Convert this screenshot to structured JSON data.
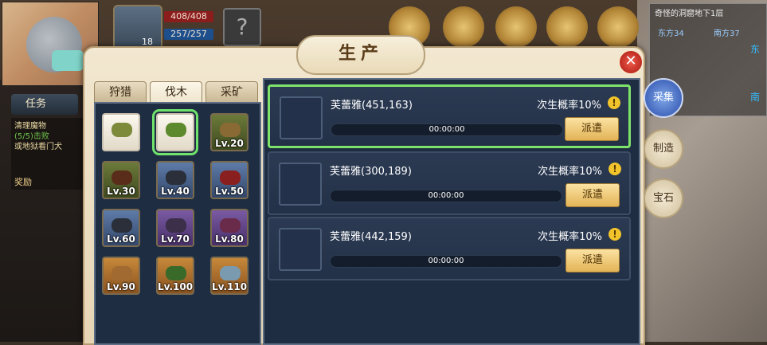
{
  "hud": {
    "hp": "408/408",
    "mp": "257/257",
    "level": "18"
  },
  "minimap": {
    "title": "奇怪的洞窟地下1层",
    "coord_a": "东方34",
    "coord_b": "南方37",
    "east": "东",
    "south": "南"
  },
  "task": {
    "tab_label": "任务",
    "line1": "清理魔物",
    "line2": "(5/5)击败",
    "line3": "或地狱看门犬",
    "reward": "奖励"
  },
  "dialog": {
    "title": "生产",
    "close": "✕",
    "tabs": [
      "狩猎",
      "伐木",
      "采矿"
    ],
    "active_tab": "伐木",
    "slots": [
      {
        "lv": "",
        "color": "white"
      },
      {
        "lv": "",
        "color": "white",
        "selected": true
      },
      {
        "lv": "Lv.20",
        "color": "green"
      },
      {
        "lv": "Lv.30",
        "color": "green"
      },
      {
        "lv": "Lv.40",
        "color": "blue"
      },
      {
        "lv": "Lv.50",
        "color": "blue"
      },
      {
        "lv": "Lv.60",
        "color": "blue"
      },
      {
        "lv": "Lv.70",
        "color": "purple"
      },
      {
        "lv": "Lv.80",
        "color": "purple"
      },
      {
        "lv": "Lv.90",
        "color": "orange"
      },
      {
        "lv": "Lv.100",
        "color": "orange"
      },
      {
        "lv": "Lv.110",
        "color": "orange"
      }
    ],
    "rows": [
      {
        "name": "芙蕾雅(451,163)",
        "chance": "次生概率10%",
        "time": "00:00:00",
        "button": "派遣",
        "selected": true
      },
      {
        "name": "芙蕾雅(300,189)",
        "chance": "次生概率10%",
        "time": "00:00:00",
        "button": "派遣"
      },
      {
        "name": "芙蕾雅(442,159)",
        "chance": "次生概率10%",
        "time": "00:00:00",
        "button": "派遣"
      }
    ]
  },
  "side_buttons": [
    {
      "label": "采集",
      "active": true
    },
    {
      "label": "制造"
    },
    {
      "label": "宝石"
    }
  ]
}
